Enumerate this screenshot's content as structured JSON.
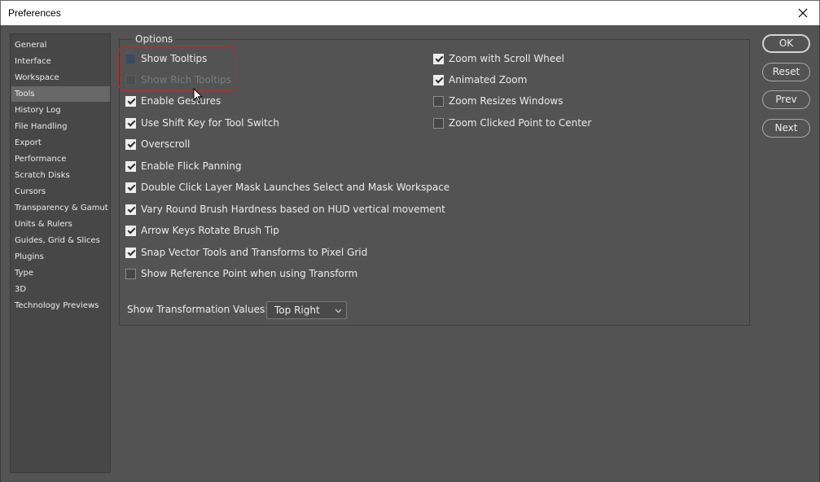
{
  "window": {
    "title": "Preferences"
  },
  "sidebar": {
    "items": [
      {
        "label": "General"
      },
      {
        "label": "Interface"
      },
      {
        "label": "Workspace"
      },
      {
        "label": "Tools"
      },
      {
        "label": "History Log"
      },
      {
        "label": "File Handling"
      },
      {
        "label": "Export"
      },
      {
        "label": "Performance"
      },
      {
        "label": "Scratch Disks"
      },
      {
        "label": "Cursors"
      },
      {
        "label": "Transparency & Gamut"
      },
      {
        "label": "Units & Rulers"
      },
      {
        "label": "Guides, Grid & Slices"
      },
      {
        "label": "Plugins"
      },
      {
        "label": "Type"
      },
      {
        "label": "3D"
      },
      {
        "label": "Technology Previews"
      }
    ],
    "active": "Tools"
  },
  "options": {
    "group_label": "Options",
    "left": [
      {
        "label": "Show Tooltips",
        "checked": false
      },
      {
        "label": "Show Rich Tooltips",
        "checked": false,
        "disabled": true
      },
      {
        "label": "Enable Gestures",
        "checked": true
      },
      {
        "label": "Use Shift Key for Tool Switch",
        "checked": true
      },
      {
        "label": "Overscroll",
        "checked": true
      },
      {
        "label": "Enable Flick Panning",
        "checked": true
      },
      {
        "label": "Double Click Layer Mask Launches Select and Mask Workspace",
        "checked": true
      },
      {
        "label": "Vary Round Brush Hardness based on HUD vertical movement",
        "checked": true
      },
      {
        "label": "Arrow Keys Rotate Brush Tip",
        "checked": true
      },
      {
        "label": "Snap Vector Tools and Transforms to Pixel Grid",
        "checked": true
      },
      {
        "label": "Show Reference Point when using Transform",
        "checked": false
      }
    ],
    "right": [
      {
        "label": "Zoom with Scroll Wheel",
        "checked": true
      },
      {
        "label": "Animated Zoom",
        "checked": true
      },
      {
        "label": "Zoom Resizes Windows",
        "checked": false
      },
      {
        "label": "Zoom Clicked Point to Center",
        "checked": false
      }
    ],
    "transform_values_label": "Show Transformation Values:",
    "transform_values_selected": "Top Right"
  },
  "buttons": {
    "ok": "OK",
    "reset": "Reset",
    "prev": "Prev",
    "next": "Next"
  },
  "colors": {
    "panel_bg": "#535353",
    "sidebar_bg": "#474747",
    "active_item_bg": "#686868",
    "highlight_annotation": "#c12b2b"
  }
}
